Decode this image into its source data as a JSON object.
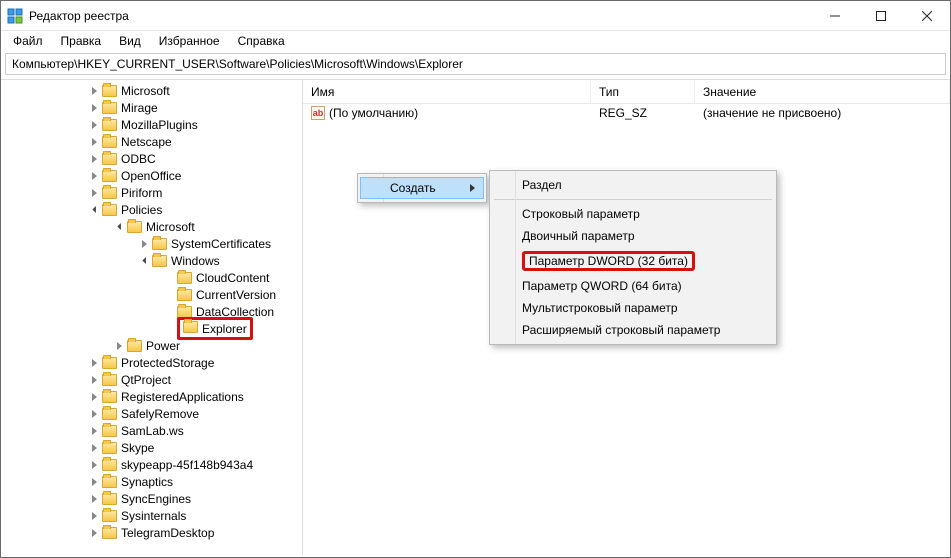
{
  "window": {
    "title": "Редактор реестра"
  },
  "menu": {
    "file": "Файл",
    "edit": "Правка",
    "view": "Вид",
    "fav": "Избранное",
    "help": "Справка"
  },
  "address": "Компьютер\\HKEY_CURRENT_USER\\Software\\Policies\\Microsoft\\Windows\\Explorer",
  "columns": {
    "name": "Имя",
    "type": "Тип",
    "value": "Значение"
  },
  "row": {
    "name": "(По умолчанию)",
    "type": "REG_SZ",
    "value": "(значение не присвоено)"
  },
  "tree": {
    "before": [
      "Microsoft",
      "Mirage",
      "MozillaPlugins",
      "Netscape",
      "ODBC",
      "OpenOffice",
      "Piriform"
    ],
    "policies": "Policies",
    "microsoft": "Microsoft",
    "ms_children_pre": [
      "SystemCertificates"
    ],
    "windows": "Windows",
    "win_children": [
      "CloudContent",
      "CurrentVersion",
      "DataCollection"
    ],
    "explorer": "Explorer",
    "after_policies_first": "Power",
    "after": [
      "ProtectedStorage",
      "QtProject",
      "RegisteredApplications",
      "SafelyRemove",
      "SamLab.ws",
      "Skype",
      "skypeapp-45f148b943a4",
      "Synaptics",
      "SyncEngines",
      "Sysinternals",
      "TelegramDesktop"
    ]
  },
  "ctx1": {
    "create": "Создать"
  },
  "ctx2": {
    "key": "Раздел",
    "string": "Строковый параметр",
    "binary": "Двоичный параметр",
    "dword": "Параметр DWORD (32 бита)",
    "qword": "Параметр QWORD (64 бита)",
    "multi": "Мультистроковый параметр",
    "expand": "Расширяемый строковый параметр"
  }
}
